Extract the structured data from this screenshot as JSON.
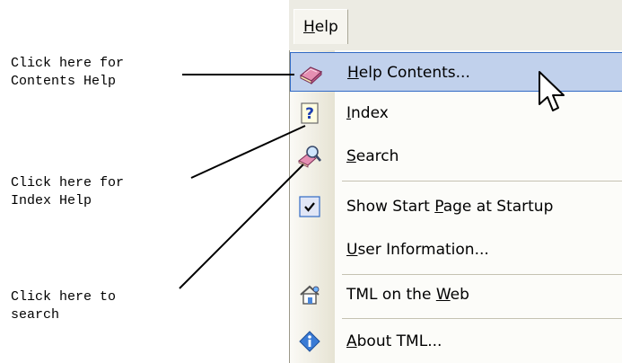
{
  "callouts": {
    "contents": "Click here for\nContents Help",
    "index": "Click here for\nIndex Help",
    "search": "Click here to\nsearch"
  },
  "menubar": {
    "help_prefix": "H",
    "help_rest": "elp"
  },
  "menu": {
    "items": [
      {
        "pre": "",
        "key": "H",
        "post": "elp Contents...",
        "icon": "help-book-icon",
        "highlighted": true
      },
      {
        "pre": "",
        "key": "I",
        "post": "ndex",
        "icon": "question-mark-icon"
      },
      {
        "pre": "",
        "key": "S",
        "post": "earch",
        "icon": "search-magnifier-icon"
      },
      {
        "pre": "Show Start ",
        "key": "P",
        "post": "age at Startup",
        "icon": "checkmark-icon",
        "checked": true
      },
      {
        "pre": "",
        "key": "U",
        "post": "ser Information...",
        "icon": ""
      },
      {
        "pre": "TML on the ",
        "key": "W",
        "post": "eb",
        "icon": "home-web-icon"
      },
      {
        "pre": "",
        "key": "A",
        "post": "bout TML...",
        "icon": "info-icon"
      }
    ]
  }
}
